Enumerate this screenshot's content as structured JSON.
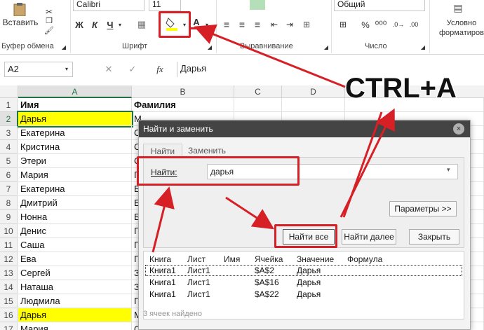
{
  "ribbon": {
    "paste_label": "Вставить",
    "clipboard_group": "Буфер обмена",
    "font_group": "Шрифт",
    "alignment_group": "Выравнивание",
    "number_group": "Число",
    "font_name": "Calibri",
    "font_size": "11",
    "number_format": "Общий",
    "bold": "Ж",
    "italic": "К",
    "underline": "Ч",
    "font_color_letter": "A",
    "fx": "fx",
    "styles_line1": "Условно",
    "styles_line2": "форматиров"
  },
  "formula_bar": {
    "name_box": "A2",
    "value": "Дарья"
  },
  "sheet": {
    "columns": [
      "A",
      "B",
      "C",
      "D"
    ],
    "header_row": [
      "Имя",
      "Фамилия"
    ],
    "row_numbers": [
      "1",
      "2",
      "3",
      "4",
      "5",
      "6",
      "7",
      "8",
      "9",
      "10",
      "11",
      "12",
      "13",
      "14",
      "15",
      "16",
      "17"
    ],
    "names": [
      "Дарья",
      "Екатерина",
      "Кристина",
      "Этери",
      "Мария",
      "Екатерина",
      "Дмитрий",
      "Нонна",
      "Денис",
      "Саша",
      "Ева",
      "Сергей",
      "Наташа",
      "Людмила",
      "Дарья",
      "Мария"
    ],
    "surname_initials": [
      "М",
      "С",
      "С",
      "С",
      "Г",
      "Е",
      "Е",
      "Б",
      "Г",
      "Г",
      "Г",
      "З",
      "З",
      "Г",
      "М",
      "Образцова"
    ],
    "highlight_color": "#ffff00"
  },
  "dialog": {
    "title": "Найти и заменить",
    "tab_find": "Найти",
    "tab_replace": "Заменить",
    "find_label": "Найти:",
    "find_value": "дарья",
    "options_button": "Параметры >>",
    "find_all_button": "Найти все",
    "find_next_button": "Найти далее",
    "close_button": "Закрыть",
    "close_icon": "×",
    "results_headers": [
      "Книга",
      "Лист",
      "Имя",
      "Ячейка",
      "Значение",
      "Формула"
    ],
    "results": [
      {
        "book": "Книга1",
        "sheet": "Лист1",
        "cell": "$A$2",
        "value": "Дарья"
      },
      {
        "book": "Книга1",
        "sheet": "Лист1",
        "cell": "$A$16",
        "value": "Дарья"
      },
      {
        "book": "Книга1",
        "sheet": "Лист1",
        "cell": "$A$22",
        "value": "Дарья"
      }
    ],
    "status": "3 ячеек найдено"
  },
  "annotation": {
    "shortcut": "CTRL+A",
    "accent": "#d71f26"
  }
}
